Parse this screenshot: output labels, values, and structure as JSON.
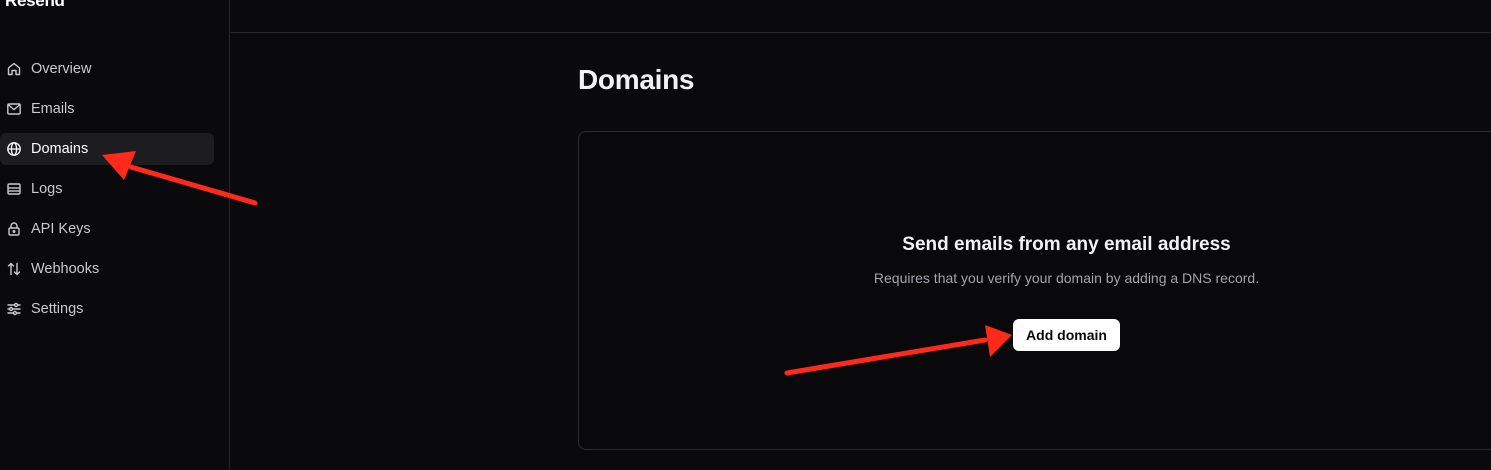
{
  "brand": {
    "name": "Resend"
  },
  "sidebar": {
    "items": [
      {
        "label": "Overview",
        "icon": "home-icon",
        "active": false
      },
      {
        "label": "Emails",
        "icon": "mail-icon",
        "active": false
      },
      {
        "label": "Domains",
        "icon": "globe-icon",
        "active": true
      },
      {
        "label": "Logs",
        "icon": "logs-icon",
        "active": false
      },
      {
        "label": "API Keys",
        "icon": "lock-icon",
        "active": false
      },
      {
        "label": "Webhooks",
        "icon": "webhooks-icon",
        "active": false
      },
      {
        "label": "Settings",
        "icon": "sliders-icon",
        "active": false
      }
    ]
  },
  "main": {
    "title": "Domains",
    "empty_state": {
      "title": "Send emails from any email address",
      "description": "Requires that you verify your domain by adding a DNS record.",
      "button_label": "Add domain"
    }
  },
  "colors": {
    "background": "#0a090c",
    "sidebar_active": "#1c1c21",
    "border": "#26252a",
    "button_bg": "#ffffff",
    "annotation_arrow": "#ff2a1a"
  }
}
